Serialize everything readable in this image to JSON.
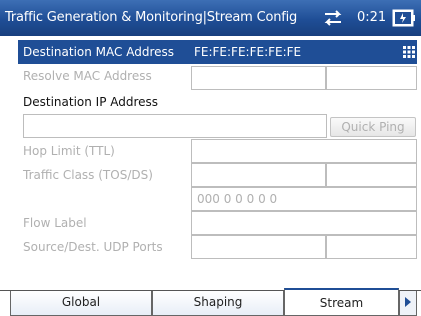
{
  "title_bar": {
    "title": "Traffic Generation  &  Monitoring|Stream Config",
    "time": "0:21",
    "icons": [
      "network-activity-icon",
      "battery-icon"
    ]
  },
  "fields": {
    "destination_mac": {
      "label": "Destination MAC Address",
      "value": "FE:FE:FE:FE:FE:FE"
    },
    "resolve_mac": {
      "label": "Resolve MAC Address"
    },
    "destination_ip": {
      "label": "Destination IP Address",
      "value": ""
    },
    "quick_ping": {
      "label": "Quick Ping"
    },
    "hop_limit": {
      "label": "Hop Limit (TTL)"
    },
    "traffic_class": {
      "label": "Traffic Class (TOS/DS)",
      "sub_value": "000 0 0 0 0 0"
    },
    "flow_label": {
      "label": "Flow Label"
    },
    "udp_ports": {
      "label": "Source/Dest. UDP Ports"
    }
  },
  "tabs": [
    {
      "label": "Global",
      "active": false
    },
    {
      "label": "Shaping",
      "active": false
    },
    {
      "label": "Stream",
      "active": true
    }
  ],
  "colors": {
    "accent": "#1f4e96",
    "disabled_text": "#b0b0b0"
  }
}
